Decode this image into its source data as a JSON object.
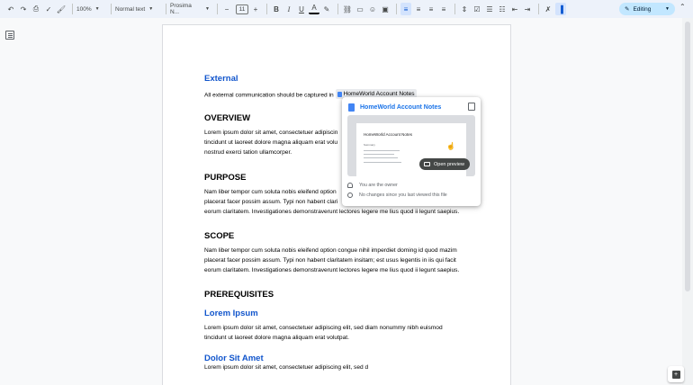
{
  "toolbar": {
    "zoom": "100%",
    "style": "Normal text",
    "font": "Prosima N...",
    "font_size": "11",
    "minus": "−",
    "plus": "+",
    "bold": "B",
    "italic": "I",
    "underline": "U",
    "text_color": "A",
    "editing_label": "Editing"
  },
  "icons": {
    "undo": "↶",
    "redo": "↷",
    "print": "⎙",
    "spellcheck": "✓",
    "paint": "🖌",
    "highlight": "✎",
    "link": "⛓",
    "comment": "▭",
    "emoji": "☺",
    "image": "▣",
    "align_left": "≡",
    "align_center": "≡",
    "align_right": "≡",
    "justify": "≡",
    "line_spacing": "⇕",
    "checklist": "☑",
    "bullets": "☰",
    "numbered": "☷",
    "indent_less": "⇤",
    "indent_more": "⇥",
    "clear_format": "✗",
    "format_side": "▐",
    "pencil": "✎",
    "caret": "▼",
    "collapse": "⌃"
  },
  "doc": {
    "external_heading": "External",
    "external_text_before": "All external communication should be captured in",
    "chip_label": "HomeWorld Account Notes",
    "overview_heading": "OVERVIEW",
    "overview_lines": [
      "Lorem ipsum dolor sit amet, consectetuer adipiscin",
      "tincidunt ut laoreet dolore magna aliquam erat volu",
      "nostrud exerci tation ullamcorper."
    ],
    "purpose_heading": "PURPOSE",
    "purpose_lines": [
      "Nam liber tempor cum soluta nobis eleifend option",
      "placerat facer possim assum. Typi non habent clari",
      "eorum claritatem. Investigationes demonstraverunt lectores legere me lius quod ii legunt saepius."
    ],
    "scope_heading": "SCOPE",
    "scope_lines": [
      "Nam liber tempor cum soluta nobis eleifend option congue nihil imperdiet doming id quod mazim",
      "placerat facer possim assum. Typi non habent claritatem insitam; est usus legentis in iis qui facit",
      "eorum claritatem. Investigationes demonstraverunt lectores legere me lius quod ii legunt saepius."
    ],
    "prereq_heading": "PREREQUISITES",
    "lorem_heading": "Lorem Ipsum",
    "lorem_lines": [
      "Lorem ipsum dolor sit amet, consectetuer adipiscing elit, sed diam nonummy nibh euismod",
      "tincidunt ut laoreet dolore magna aliquam erat volutpat."
    ],
    "dolor_heading": "Dolor Sit Amet",
    "dolor_lines": [
      "Lorem ipsum dolor sit amet, consectetuer adipiscing elit, sed d"
    ]
  },
  "popup": {
    "title": "HomeWorld Account Notes",
    "preview_title": "HomeWorld Account Notes",
    "preview_summary": "Summary",
    "open_preview": "Open preview",
    "owner_text": "You are the owner",
    "changes_text": "No changes since you last viewed this file"
  },
  "colors": {
    "accent": "#1155cc",
    "toolbar_bg": "#edf2fa",
    "editing_bg": "#c2e7ff"
  }
}
